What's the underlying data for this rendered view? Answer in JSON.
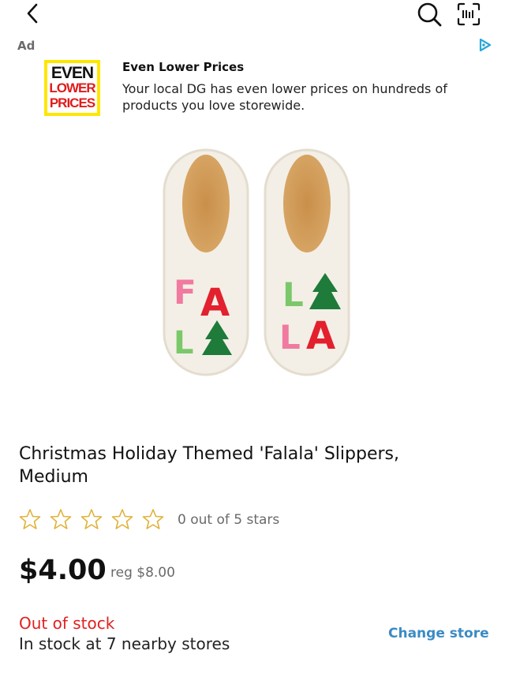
{
  "header": {
    "back_icon": "chevron-left-icon",
    "search_icon": "search-icon",
    "scan_icon": "barcode-scan-icon"
  },
  "ad": {
    "badge": "Ad",
    "logo": {
      "line1": "EVEN",
      "line2": "LOWER",
      "line3": "PRICES"
    },
    "title": "Even Lower Prices",
    "body": "Your local DG has even lower prices on hundreds of products you love storewide.",
    "choice_icon": "adchoices-icon"
  },
  "product": {
    "title": "Christmas Holiday Themed 'Falala' Slippers, Medium",
    "image_letters": {
      "left": [
        "F",
        "A",
        "L",
        "A"
      ],
      "right": [
        "L",
        "A",
        "L",
        "A"
      ]
    },
    "rating": {
      "value": 0,
      "max": 5,
      "text": "0 out of 5 stars"
    },
    "price": "$4.00",
    "regular_price": "reg $8.00",
    "stock_status": "Out of stock",
    "availability": "In stock at 7 nearby stores",
    "change_store_label": "Change store"
  },
  "colors": {
    "accent_link": "#3a8bc4",
    "out_of_stock": "#e02020",
    "star_outline": "#e0b23a",
    "ad_logo_yellow": "#ffe600",
    "ad_logo_red": "#e01b1b"
  }
}
